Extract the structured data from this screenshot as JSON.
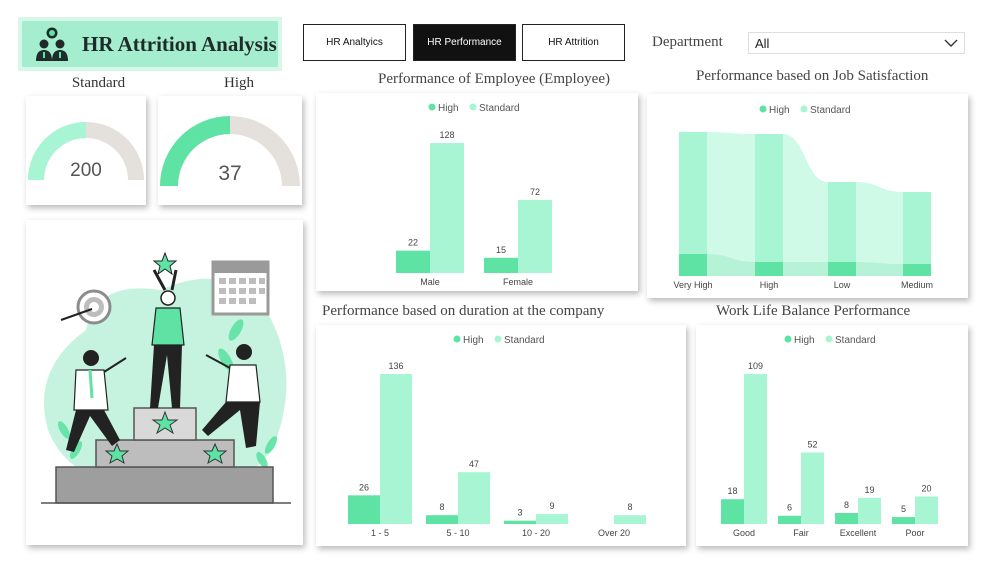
{
  "header": {
    "title": "HR Attrition Analysis"
  },
  "nav": [
    {
      "label": "HR Analtyics",
      "active": false
    },
    {
      "label": "HR Performance",
      "active": true
    },
    {
      "label": "HR Attrition",
      "active": false
    }
  ],
  "filter": {
    "label": "Department",
    "value": "All"
  },
  "colors": {
    "high": "#5ee3a4",
    "standard": "#a8f5d4",
    "track": "#e4e0db",
    "accent": "#a4edce"
  },
  "kpis": [
    {
      "label": "Standard",
      "value": 200,
      "fraction": 0.5
    },
    {
      "label": "High",
      "value": 37,
      "fraction": 0.5
    }
  ],
  "legend": {
    "high": "High",
    "standard": "Standard"
  },
  "charts": {
    "gender": {
      "title": "Performance of Employee (Employee)",
      "chart_data": {
        "type": "bar",
        "categories": [
          "Male",
          "Female"
        ],
        "series": [
          {
            "name": "High",
            "values": [
              22,
              15
            ]
          },
          {
            "name": "Standard",
            "values": [
              128,
              72
            ]
          }
        ]
      }
    },
    "satisfaction": {
      "title": "Performance based on Job Satisfaction",
      "chart_data": {
        "type": "area",
        "categories": [
          "Very High",
          "High",
          "Low",
          "Medium"
        ],
        "series": [
          {
            "name": "High",
            "values": [
              11,
              7,
              7,
              6
            ]
          },
          {
            "name": "Standard",
            "values": [
              61,
              64,
              40,
              36
            ]
          }
        ]
      }
    },
    "duration": {
      "title": "Performance based on duration at the company",
      "chart_data": {
        "type": "bar",
        "categories": [
          "1 - 5",
          "5 - 10",
          "10 - 20",
          "Over 20"
        ],
        "series": [
          {
            "name": "High",
            "values": [
              26,
              8,
              3,
              null
            ]
          },
          {
            "name": "Standard",
            "values": [
              136,
              47,
              9,
              8
            ]
          }
        ]
      }
    },
    "wlb": {
      "title": "Work Life Balance Performance",
      "chart_data": {
        "type": "bar",
        "categories": [
          "Good",
          "Fair",
          "Excellent",
          "Poor"
        ],
        "series": [
          {
            "name": "High",
            "values": [
              18,
              6,
              8,
              5
            ]
          },
          {
            "name": "Standard",
            "values": [
              109,
              52,
              19,
              20
            ]
          }
        ]
      }
    }
  }
}
